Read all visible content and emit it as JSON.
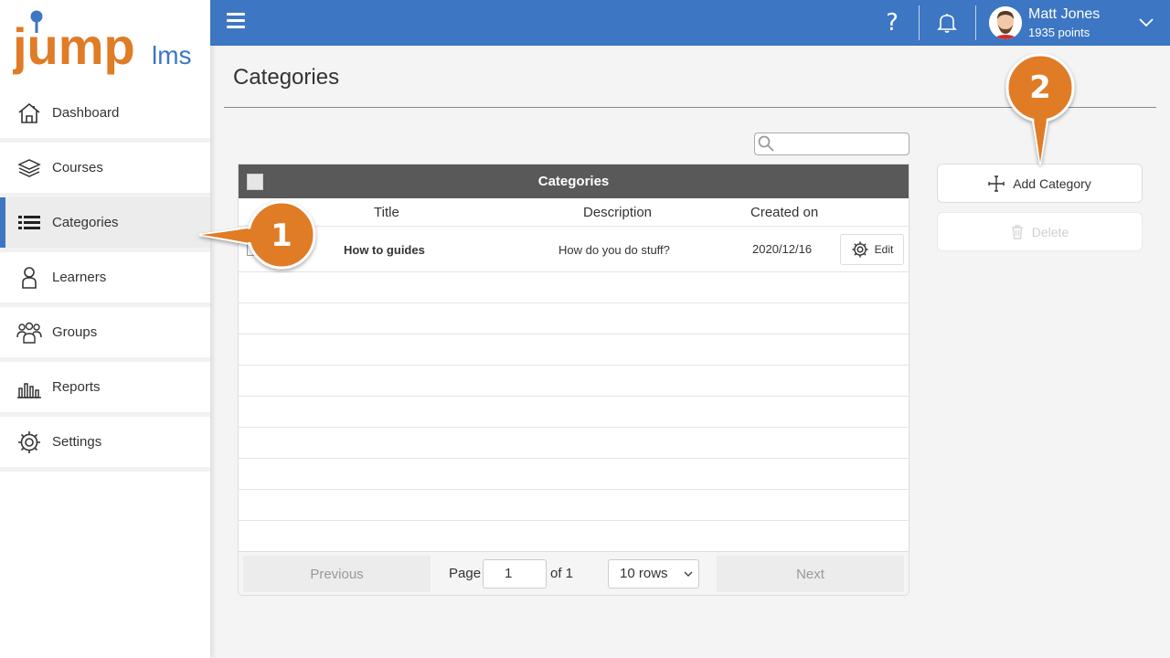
{
  "app": {
    "logo_main": "jump",
    "logo_sub": "lms",
    "brand_color": "#3d76c2",
    "logo_color": "#e07b26"
  },
  "sidebar": {
    "items": [
      {
        "label": "Dashboard",
        "icon": "home-icon",
        "active": false
      },
      {
        "label": "Courses",
        "icon": "books-icon",
        "active": false
      },
      {
        "label": "Categories",
        "icon": "list-icon",
        "active": true
      },
      {
        "label": "Learners",
        "icon": "person-icon",
        "active": false
      },
      {
        "label": "Groups",
        "icon": "group-icon",
        "active": false
      },
      {
        "label": "Reports",
        "icon": "bar-chart-icon",
        "active": false
      },
      {
        "label": "Settings",
        "icon": "gear-icon",
        "active": false
      }
    ]
  },
  "header": {
    "help_glyph": "?",
    "user": {
      "name": "Matt Jones",
      "points": "1935 points"
    }
  },
  "main": {
    "title": "Categories",
    "search": {
      "value": "",
      "placeholder": ""
    },
    "grid": {
      "header_title": "Categories",
      "columns": [
        "Title",
        "Description",
        "Created on"
      ],
      "rows": [
        {
          "title": "How to guides",
          "description": "How do you do stuff?",
          "created_on": "2020/12/16",
          "edit_label": "Edit"
        }
      ]
    },
    "pager": {
      "previous_label": "Previous",
      "next_label": "Next",
      "page_label": "Page",
      "page_value": "1",
      "of_label": "of 1",
      "rows_label": "10 rows"
    },
    "actions": {
      "add_label": "Add Category",
      "delete_label": "Delete"
    }
  },
  "callouts": [
    {
      "number": "1",
      "color": "#e07b26"
    },
    {
      "number": "2",
      "color": "#e07b26"
    }
  ]
}
